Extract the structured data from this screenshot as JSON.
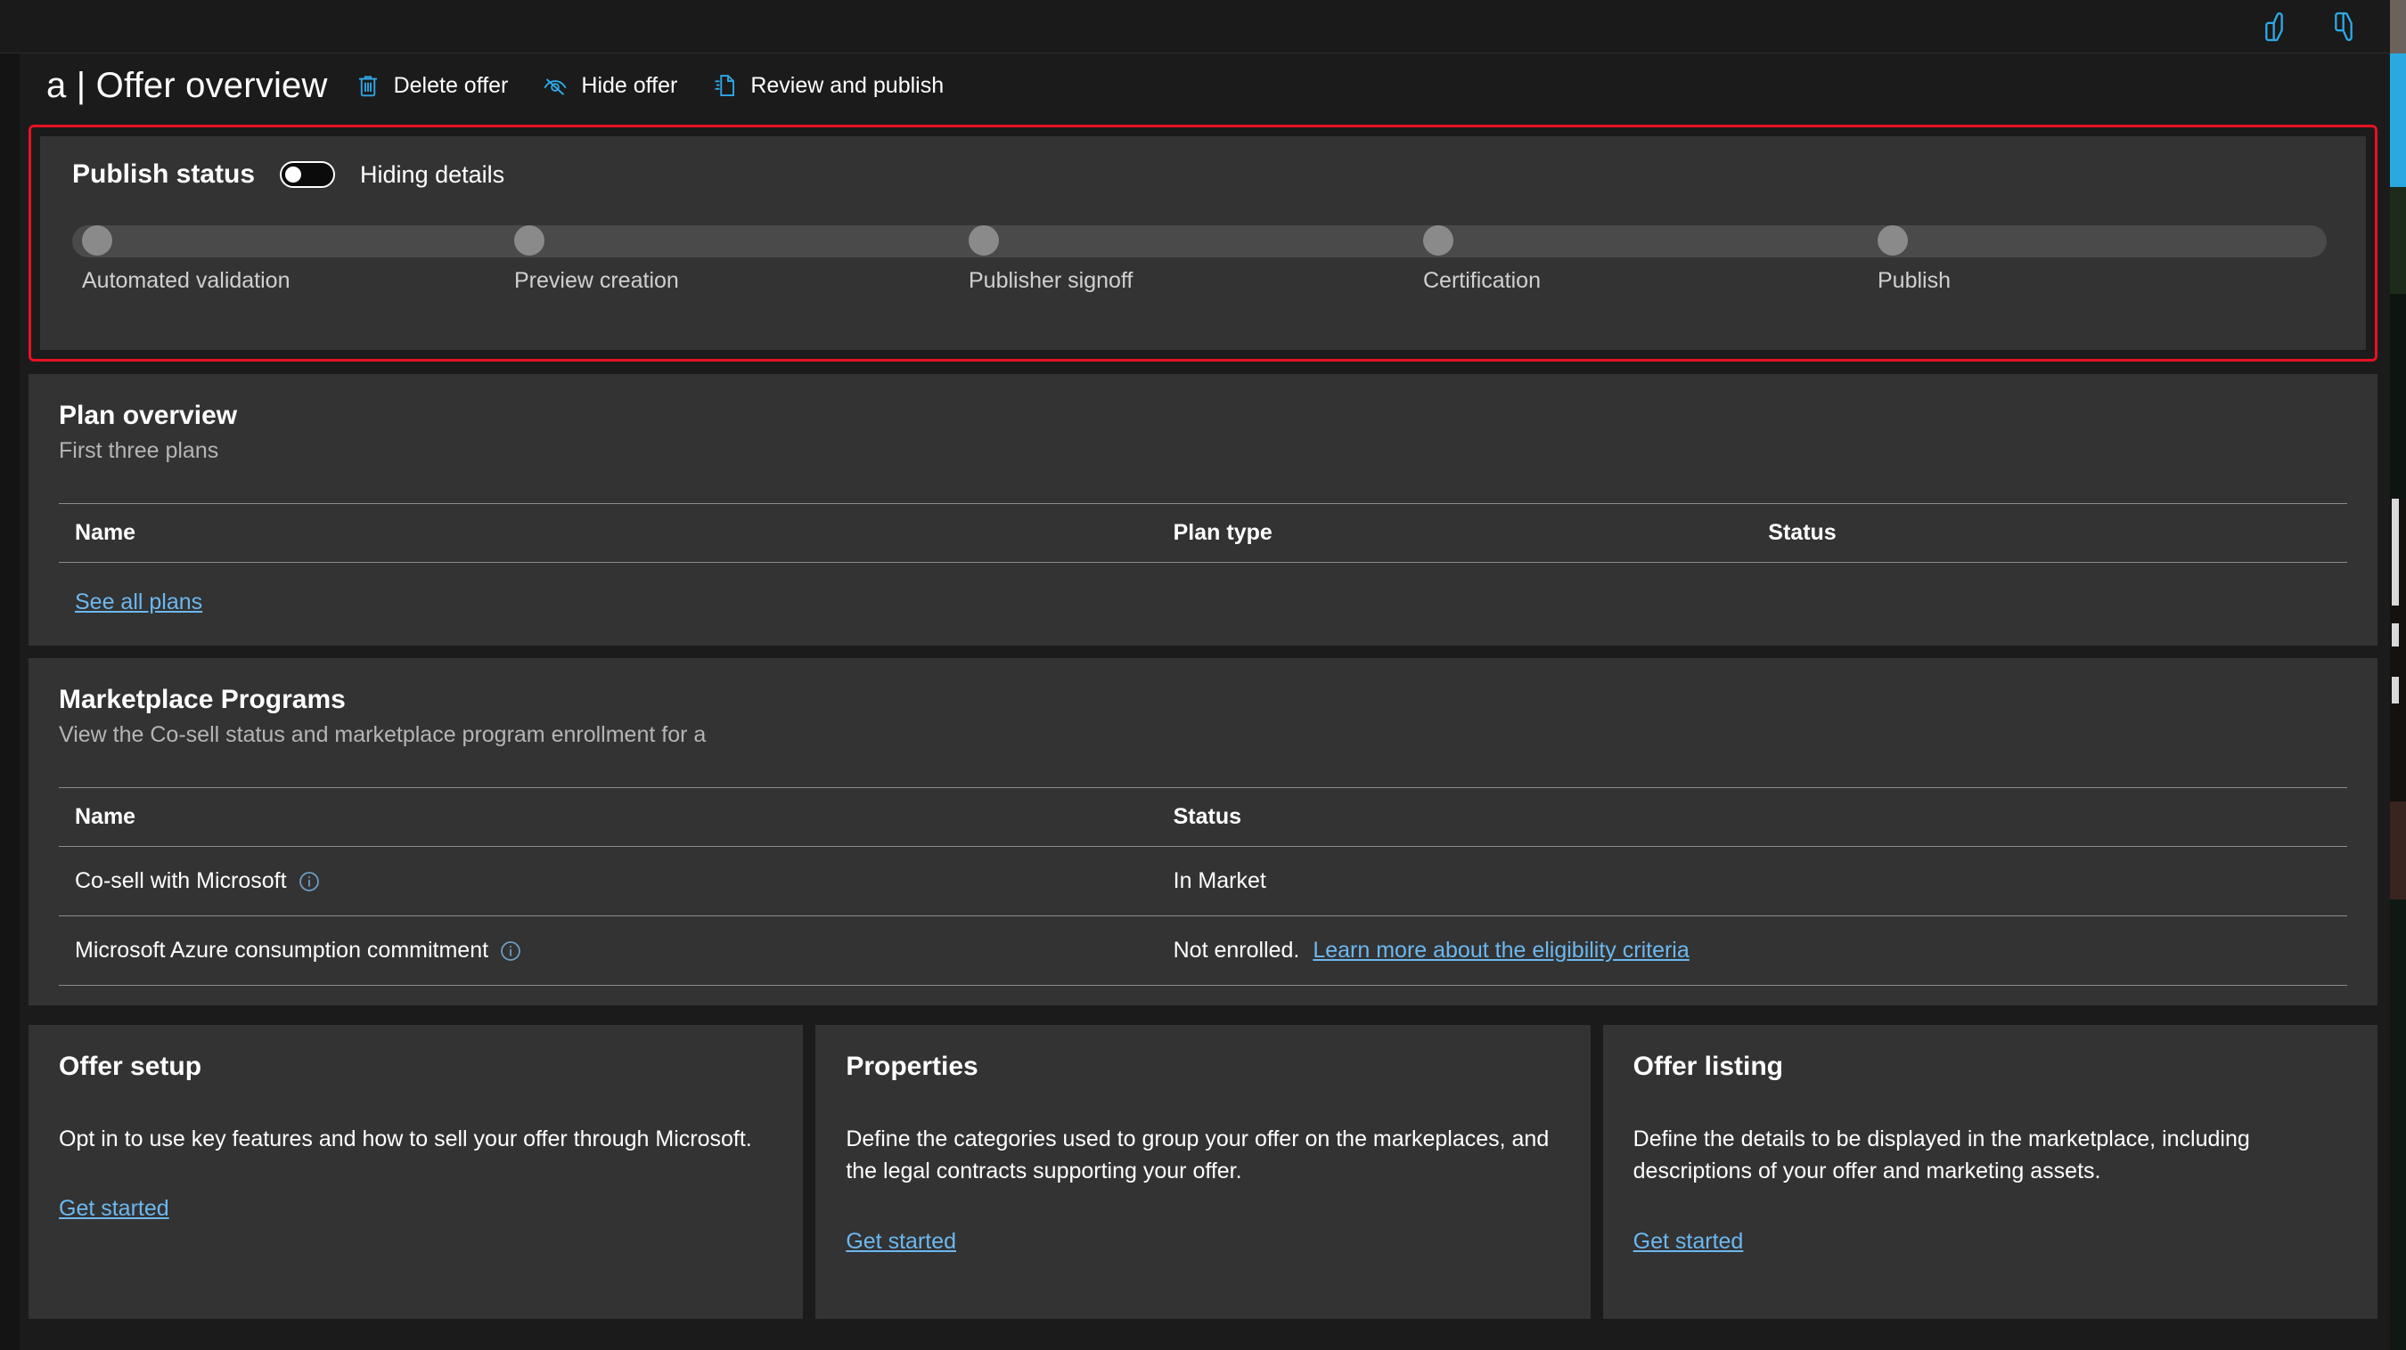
{
  "topbar": {
    "feedback_up_icon": "thumbs-up-icon",
    "feedback_down_icon": "thumbs-down-icon"
  },
  "command_bar": {
    "title": "a | Offer overview",
    "actions": [
      {
        "label": "Delete offer",
        "icon": "trash-icon"
      },
      {
        "label": "Hide offer",
        "icon": "eye-off-icon"
      },
      {
        "label": "Review and publish",
        "icon": "document-icon"
      }
    ]
  },
  "publish_status": {
    "title": "Publish status",
    "toggle_label": "Hiding details",
    "toggle_state": "off",
    "steps": [
      {
        "label": "Automated validation"
      },
      {
        "label": "Preview creation"
      },
      {
        "label": "Publisher signoff"
      },
      {
        "label": "Certification"
      },
      {
        "label": "Publish"
      }
    ]
  },
  "plan_overview": {
    "title": "Plan overview",
    "subtitle": "First three plans",
    "columns": [
      "Name",
      "Plan type",
      "Status"
    ],
    "rows": [],
    "see_all_label": "See all plans"
  },
  "marketplace_programs": {
    "title": "Marketplace Programs",
    "subtitle": "View the Co-sell status and marketplace program enrollment for a",
    "columns": [
      "Name",
      "Status"
    ],
    "rows": [
      {
        "name": "Co-sell with Microsoft",
        "info_icon": "info-icon",
        "status_text": "In Market",
        "status_link": ""
      },
      {
        "name": "Microsoft Azure consumption commitment",
        "info_icon": "info-icon",
        "status_text": "Not enrolled.",
        "status_link": "Learn more about the eligibility criteria"
      }
    ]
  },
  "tiles": [
    {
      "title": "Offer setup",
      "body": "Opt in to use key features and how to sell your offer through Microsoft.",
      "link": "Get started"
    },
    {
      "title": "Properties",
      "body": "Define the categories used to group your offer on the markeplaces, and the legal contracts supporting your offer.",
      "link": "Get started"
    },
    {
      "title": "Offer listing",
      "body": "Define the details to be displayed in the marketplace, including descriptions of your offer and marketing assets.",
      "link": "Get started"
    }
  ],
  "colors": {
    "accent_link": "#6cb8f0",
    "focus_ring": "#e81123",
    "card_bg": "#333333",
    "page_bg": "#1b1b1b"
  }
}
